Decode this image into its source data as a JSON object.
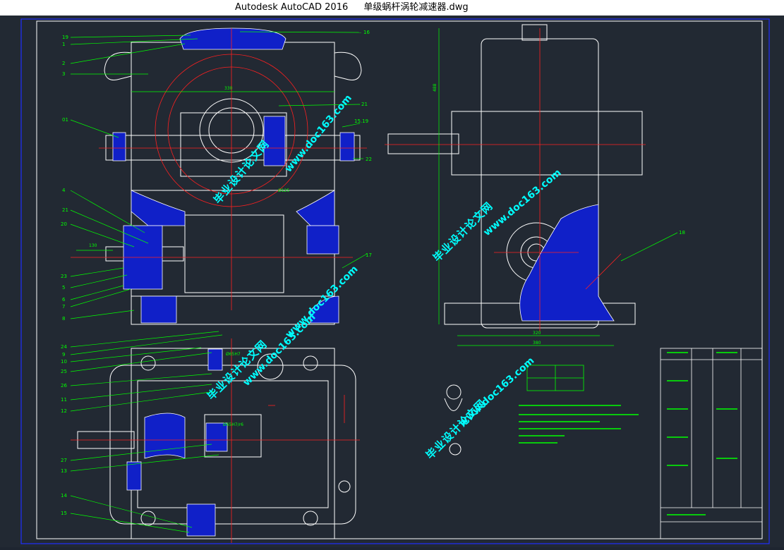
{
  "window": {
    "app_title": "Autodesk AutoCAD 2016",
    "document_title": "单级蜗杆涡轮减速器.dwg"
  },
  "colors": {
    "titlebar_bg": "#ffffff",
    "canvas_bg": "#222933",
    "outline": "#ffffff",
    "leader": "#00ff00",
    "section_fill": "#1020c8",
    "center_line": "#ff2020",
    "frame": "#2030ff",
    "watermark": "#00ffff"
  },
  "drawing": {
    "part_numbers_left": [
      "19",
      "1",
      "2",
      "3",
      "01",
      "4",
      "21",
      "20",
      "23",
      "5",
      "6",
      "7",
      "8",
      "24",
      "9",
      "10",
      "25",
      "26",
      "11",
      "12",
      "27",
      "13",
      "14",
      "15"
    ],
    "part_numbers_right": [
      "16",
      "21",
      "15.19",
      "22",
      "17",
      "18"
    ],
    "dimensions": {
      "main_width": "330",
      "shaft_length": "130",
      "fit_1": "Ø125",
      "fit_2": "Ø65H7",
      "fit_3": "Ø65H7/r6",
      "side_width_1": "320",
      "side_width_2": "380",
      "side_height": "488"
    },
    "watermarks": [
      "毕业设计论文网",
      "www.doc163.com"
    ]
  }
}
